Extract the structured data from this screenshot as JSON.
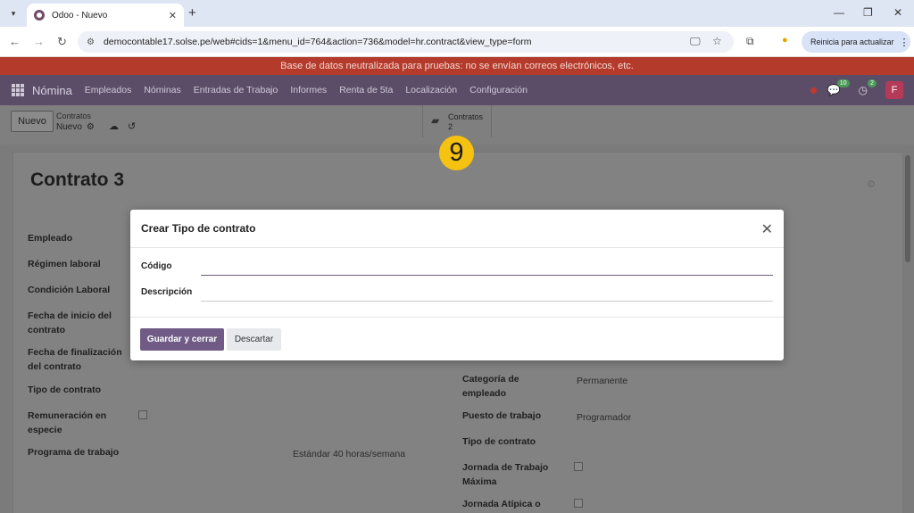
{
  "browser": {
    "tab_title": "Odoo - Nuevo",
    "url": "democontable17.solse.pe/web#cids=1&menu_id=764&action=736&model=hr.contract&view_type=form",
    "update_label": "Reinicia para actualizar"
  },
  "banner": "Base de datos neutralizada para pruebas: no se envían correos electrónicos, etc.",
  "navbar": {
    "app_name": "Nómina",
    "items": [
      "Empleados",
      "Nóminas",
      "Entradas de Trabajo",
      "Informes",
      "Renta de 5ta",
      "Localización",
      "Configuración"
    ],
    "chat_count": "10",
    "activity_count": "2",
    "avatar_letter": "F"
  },
  "control_panel": {
    "new_label": "Nuevo",
    "breadcrumb_parent": "Contratos",
    "breadcrumb_current": "Nuevo",
    "smart_button_label": "Contratos",
    "smart_button_value": "2"
  },
  "step_marker": "9",
  "form": {
    "title": "Contrato 3",
    "left_labels": [
      "Empleado",
      "Régimen laboral",
      "Condición Laboral",
      "Fecha de inicio del contrato",
      "Fecha de finalización del contrato",
      "Tipo de contrato",
      "Remuneración en especie",
      "Programa de trabajo"
    ],
    "work_schedule_value": "Estándar 40 horas/semana",
    "right_labels": [
      "Categoría de empleado",
      "Puesto de trabajo",
      "Tipo de contrato",
      "Jornada de Trabajo Máxima",
      "Jornada Atípica o"
    ],
    "category_value": "Permanente",
    "job_value": "Programador"
  },
  "modal": {
    "title": "Crear Tipo de contrato",
    "code_label": "Código",
    "code_value": "",
    "description_label": "Descripción",
    "description_value": "",
    "save_label": "Guardar y cerrar",
    "discard_label": "Descartar"
  }
}
